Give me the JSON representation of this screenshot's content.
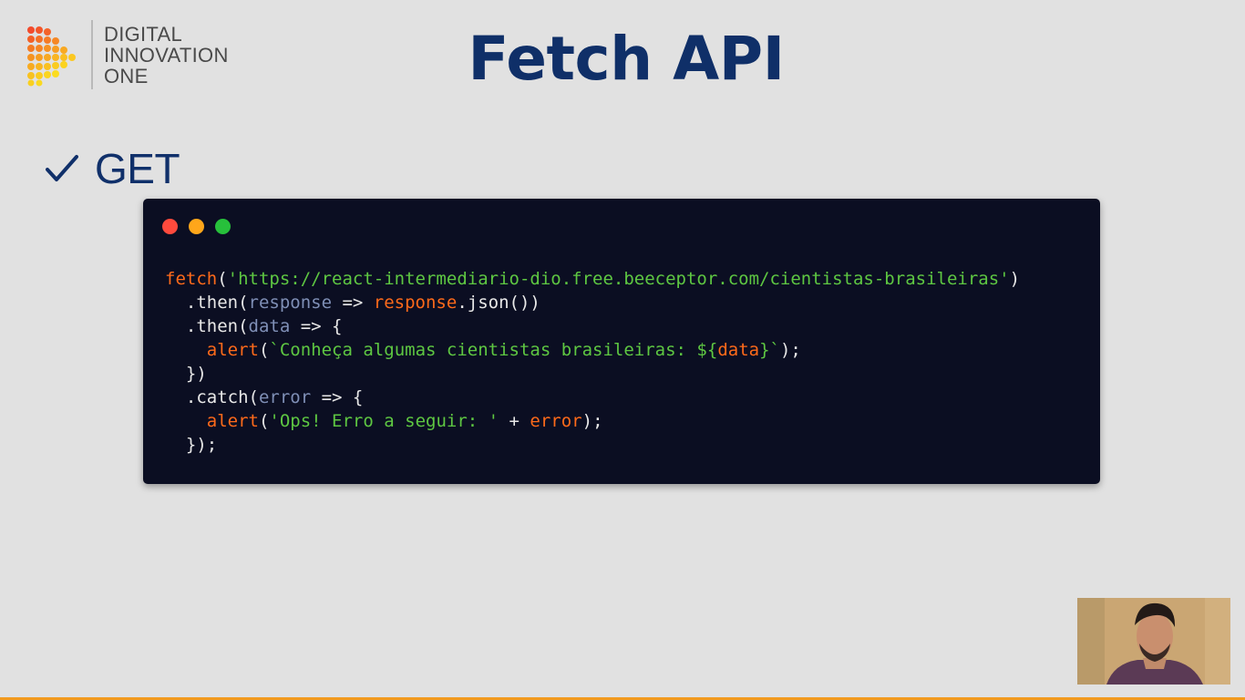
{
  "logo": {
    "line1": "DIGITAL",
    "line2": "INNOVATION",
    "line3": "ONE",
    "icon": "dio-dots-play-icon"
  },
  "slide": {
    "title": "Fetch API",
    "bullet_icon": "check-icon",
    "bullet_label": "GET"
  },
  "code_window": {
    "dots": [
      "#ff4a3d",
      "#ffa61a",
      "#27c03b"
    ],
    "lines": [
      [
        {
          "t": "fetch",
          "c": "fn"
        },
        {
          "t": "(",
          "c": "plain"
        },
        {
          "t": "'https://react-intermediario-dio.free.beeceptor.com/cientistas-brasileiras'",
          "c": "str"
        },
        {
          "t": ")",
          "c": "plain"
        }
      ],
      [
        {
          "t": "  .then(",
          "c": "plain"
        },
        {
          "t": "response",
          "c": "param"
        },
        {
          "t": " => ",
          "c": "plain"
        },
        {
          "t": "response",
          "c": "fn"
        },
        {
          "t": ".json())",
          "c": "plain"
        }
      ],
      [
        {
          "t": "  .then(",
          "c": "plain"
        },
        {
          "t": "data",
          "c": "param"
        },
        {
          "t": " => {",
          "c": "plain"
        }
      ],
      [
        {
          "t": "    ",
          "c": "plain"
        },
        {
          "t": "alert",
          "c": "fn"
        },
        {
          "t": "(",
          "c": "plain"
        },
        {
          "t": "`Conheça algumas cientistas brasileiras: ${",
          "c": "str"
        },
        {
          "t": "data",
          "c": "fn"
        },
        {
          "t": "}`",
          "c": "str"
        },
        {
          "t": ");",
          "c": "plain"
        }
      ],
      [
        {
          "t": "  })",
          "c": "plain"
        }
      ],
      [
        {
          "t": "  .catch(",
          "c": "plain"
        },
        {
          "t": "error",
          "c": "param"
        },
        {
          "t": " => {",
          "c": "plain"
        }
      ],
      [
        {
          "t": "    ",
          "c": "plain"
        },
        {
          "t": "alert",
          "c": "fn"
        },
        {
          "t": "(",
          "c": "plain"
        },
        {
          "t": "'Ops! Erro a seguir: '",
          "c": "str"
        },
        {
          "t": " + ",
          "c": "plain"
        },
        {
          "t": "error",
          "c": "fn"
        },
        {
          "t": ");",
          "c": "plain"
        }
      ],
      [
        {
          "t": "  });",
          "c": "plain"
        }
      ]
    ]
  },
  "colors": {
    "title": "#0f2f68",
    "background": "#e1e1e1",
    "code_bg": "#0b0e22",
    "token_fn": "#ff6a1a",
    "token_str": "#5ec742",
    "token_param": "#7f8fb6"
  },
  "webcam": {
    "icon": "presenter-video-icon"
  }
}
